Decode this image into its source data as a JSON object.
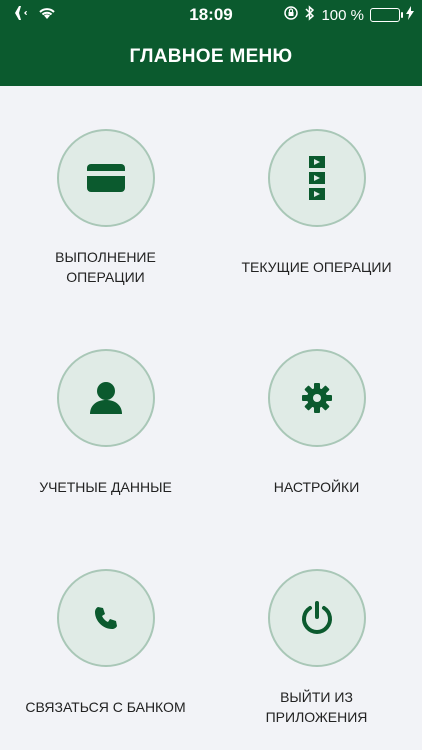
{
  "status_bar": {
    "time": "18:09",
    "battery": "100 %"
  },
  "header": {
    "title": "ГЛАВНОЕ МЕНЮ"
  },
  "menu": [
    {
      "label_line1": "ВЫПОЛНЕНИЕ",
      "label_line2": "ОПЕРАЦИИ",
      "icon": "card-icon"
    },
    {
      "label_line1": "ТЕКУЩИЕ ОПЕРАЦИИ",
      "label_line2": "",
      "icon": "list-play-icon"
    },
    {
      "label_line1": "УЧЕТНЫЕ ДАННЫЕ",
      "label_line2": "",
      "icon": "user-icon"
    },
    {
      "label_line1": "НАСТРОЙКИ",
      "label_line2": "",
      "icon": "gear-icon"
    },
    {
      "label_line1": "СВЯЗАТЬСЯ С БАНКОМ",
      "label_line2": "",
      "icon": "phone-icon"
    },
    {
      "label_line1": "ВЫЙТИ ИЗ",
      "label_line2": "ПРИЛОЖЕНИЯ",
      "icon": "power-icon"
    }
  ],
  "colors": {
    "brand": "#0b5a2e",
    "circle_fill": "#e0ebe6",
    "circle_border": "#a9c7b7",
    "background": "#f2f3f7"
  }
}
